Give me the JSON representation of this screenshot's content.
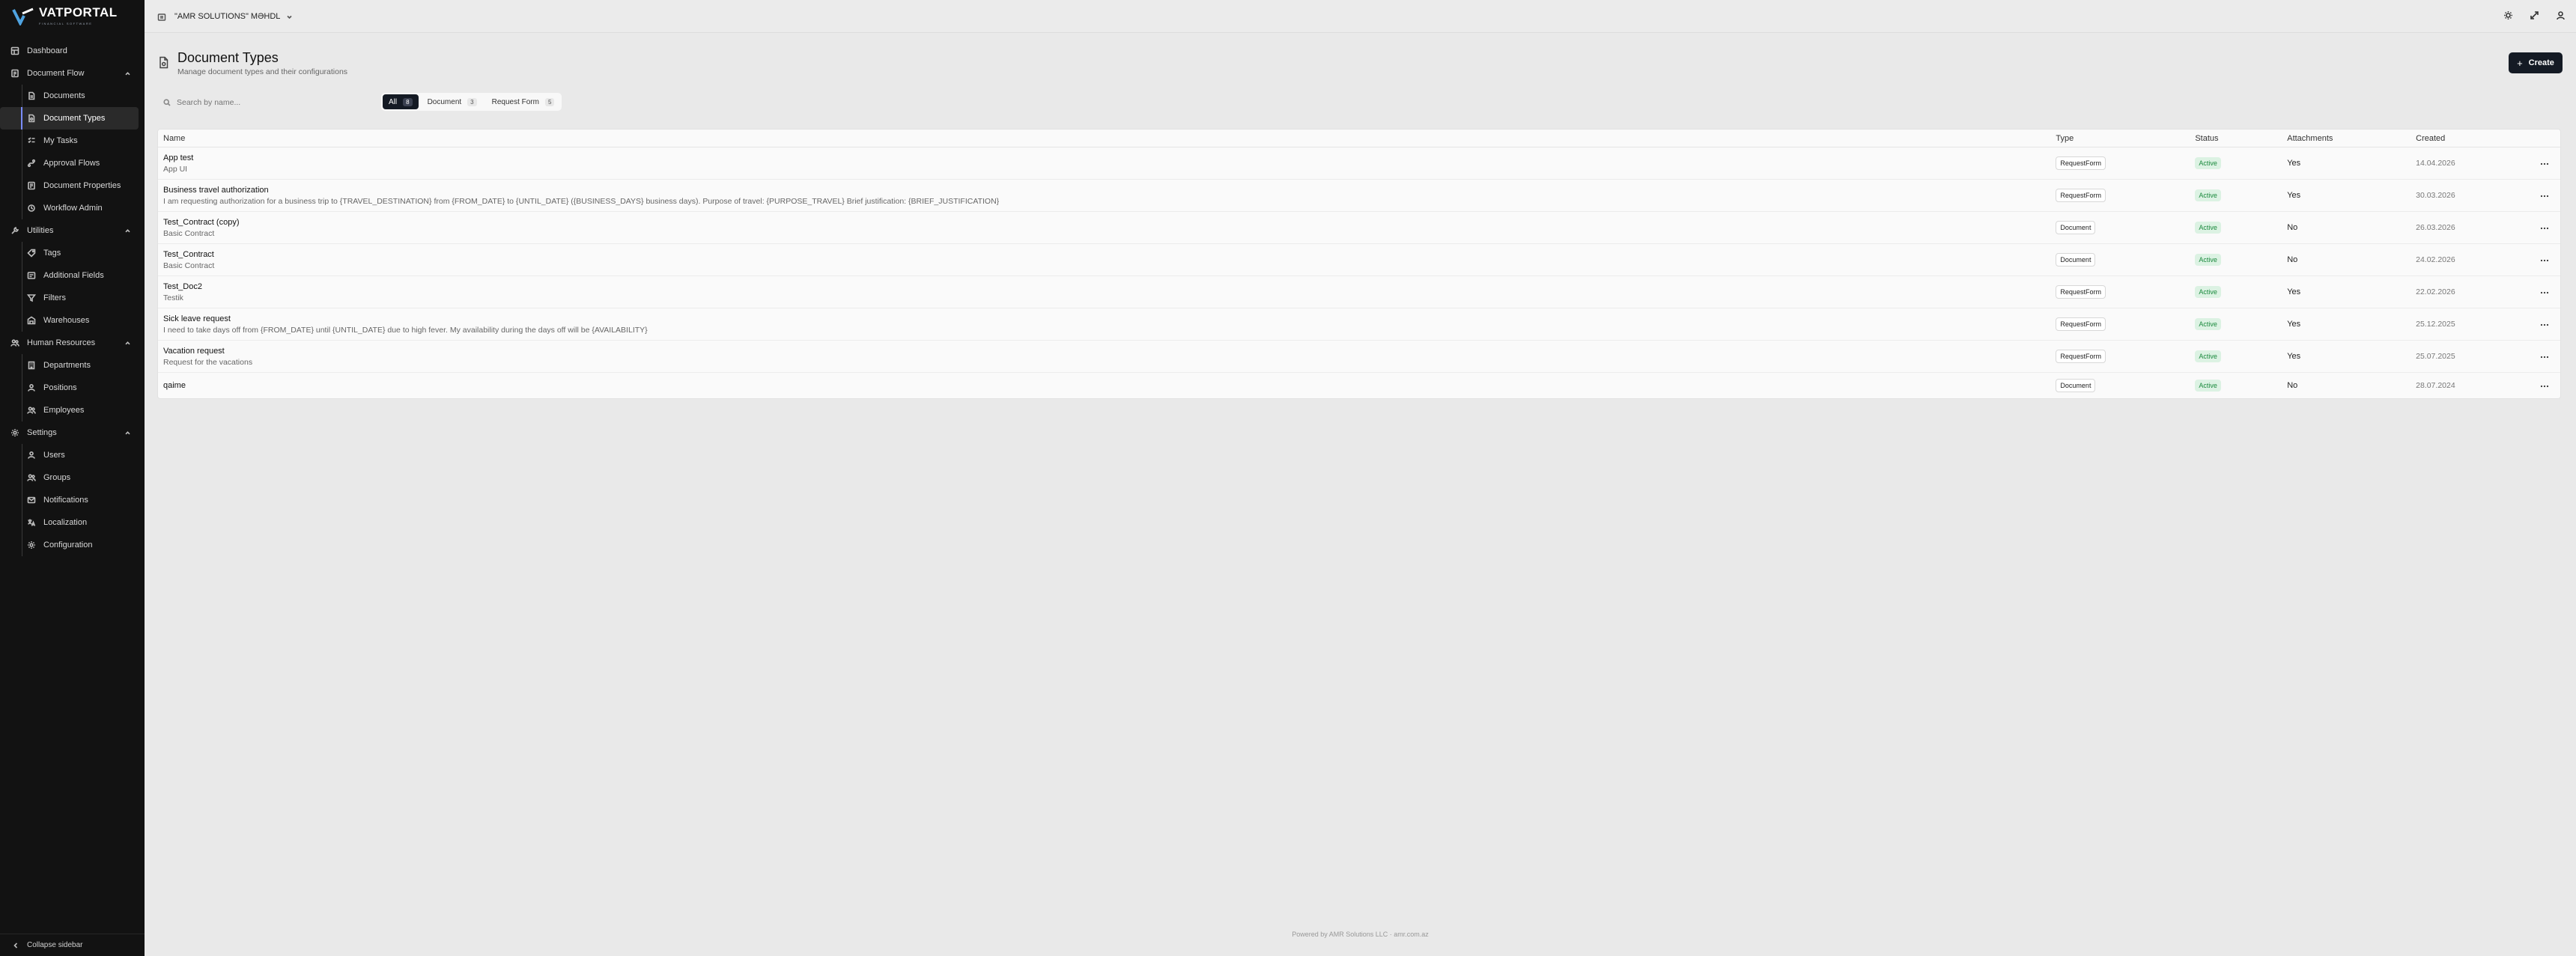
{
  "app": {
    "logo_text": "VATPORTAL",
    "logo_subtext": "FINANCIAL SOFTWARE"
  },
  "sidebar": {
    "items": [
      {
        "label": "Dashboard",
        "icon": "dashboard-icon",
        "level": 0
      },
      {
        "label": "Document Flow",
        "icon": "document-flow-icon",
        "level": 0,
        "group": true,
        "expanded": true
      },
      {
        "label": "Documents",
        "icon": "file-icon",
        "level": 1
      },
      {
        "label": "Document Types",
        "icon": "file-type-icon",
        "level": 1,
        "active": true
      },
      {
        "label": "My Tasks",
        "icon": "tasks-icon",
        "level": 1
      },
      {
        "label": "Approval Flows",
        "icon": "flow-icon",
        "level": 1
      },
      {
        "label": "Document Properties",
        "icon": "properties-icon",
        "level": 1
      },
      {
        "label": "Workflow Admin",
        "icon": "admin-icon",
        "level": 1
      },
      {
        "label": "Utilities",
        "icon": "wrench-icon",
        "level": 0,
        "group": true,
        "expanded": true
      },
      {
        "label": "Tags",
        "icon": "tag-icon",
        "level": 1
      },
      {
        "label": "Additional Fields",
        "icon": "fields-icon",
        "level": 1
      },
      {
        "label": "Filters",
        "icon": "filter-icon",
        "level": 1
      },
      {
        "label": "Warehouses",
        "icon": "warehouse-icon",
        "level": 1
      },
      {
        "label": "Human Resources",
        "icon": "people-icon",
        "level": 0,
        "group": true,
        "expanded": true
      },
      {
        "label": "Departments",
        "icon": "building-icon",
        "level": 1
      },
      {
        "label": "Positions",
        "icon": "user-icon",
        "level": 1
      },
      {
        "label": "Employees",
        "icon": "users-icon",
        "level": 1
      },
      {
        "label": "Settings",
        "icon": "gear-icon",
        "level": 0,
        "group": true,
        "expanded": true
      },
      {
        "label": "Users",
        "icon": "user-icon",
        "level": 1
      },
      {
        "label": "Groups",
        "icon": "users-icon",
        "level": 1
      },
      {
        "label": "Notifications",
        "icon": "mail-icon",
        "level": 1
      },
      {
        "label": "Localization",
        "icon": "translate-icon",
        "level": 1
      },
      {
        "label": "Configuration",
        "icon": "gear-icon",
        "level": 1
      }
    ],
    "collapse_label": "Collapse sidebar"
  },
  "topbar": {
    "company": "\"AMR SOLUTIONS\" MƏHDL"
  },
  "page": {
    "title": "Document Types",
    "subtitle": "Manage document types and their configurations",
    "create_label": "Create"
  },
  "search": {
    "placeholder": "Search by name..."
  },
  "filters": [
    {
      "label": "All",
      "count": "8",
      "active": true
    },
    {
      "label": "Document",
      "count": "3",
      "active": false
    },
    {
      "label": "Request Form",
      "count": "5",
      "active": false
    }
  ],
  "table": {
    "columns": [
      "Name",
      "Type",
      "Status",
      "Attachments",
      "Created"
    ],
    "rows": [
      {
        "name": "App test",
        "desc": "App UI",
        "type": "RequestForm",
        "status": "Active",
        "attachments": "Yes",
        "created": "14.04.2026"
      },
      {
        "name": "Business travel authorization",
        "desc": "I am requesting authorization for a business trip to {TRAVEL_DESTINATION} from {FROM_DATE} to {UNTIL_DATE} ({BUSINESS_DAYS} business days). Purpose of travel: {PURPOSE_TRAVEL} Brief justification: {BRIEF_JUSTIFICATION}",
        "type": "RequestForm",
        "status": "Active",
        "attachments": "Yes",
        "created": "30.03.2026"
      },
      {
        "name": "Test_Contract (copy)",
        "desc": "Basic Contract",
        "type": "Document",
        "status": "Active",
        "attachments": "No",
        "created": "26.03.2026"
      },
      {
        "name": "Test_Contract",
        "desc": "Basic Contract",
        "type": "Document",
        "status": "Active",
        "attachments": "No",
        "created": "24.02.2026"
      },
      {
        "name": "Test_Doc2",
        "desc": "Testik",
        "type": "RequestForm",
        "status": "Active",
        "attachments": "Yes",
        "created": "22.02.2026"
      },
      {
        "name": "Sick leave request",
        "desc": "I need to take days off from {FROM_DATE} until {UNTIL_DATE} due to high fever. My availability during the days off will be {AVAILABILITY}",
        "type": "RequestForm",
        "status": "Active",
        "attachments": "Yes",
        "created": "25.12.2025"
      },
      {
        "name": "Vacation request",
        "desc": "Request for the vacations",
        "type": "RequestForm",
        "status": "Active",
        "attachments": "Yes",
        "created": "25.07.2025"
      },
      {
        "name": "qaime",
        "desc": "",
        "type": "Document",
        "status": "Active",
        "attachments": "No",
        "created": "28.07.2024"
      }
    ]
  },
  "footer": {
    "text": "Powered by AMR Solutions LLC · amr.com.az"
  },
  "colors": {
    "sidebar_bg": "#121212",
    "accent": "#141a24",
    "status_active": "#1c8a3e"
  }
}
